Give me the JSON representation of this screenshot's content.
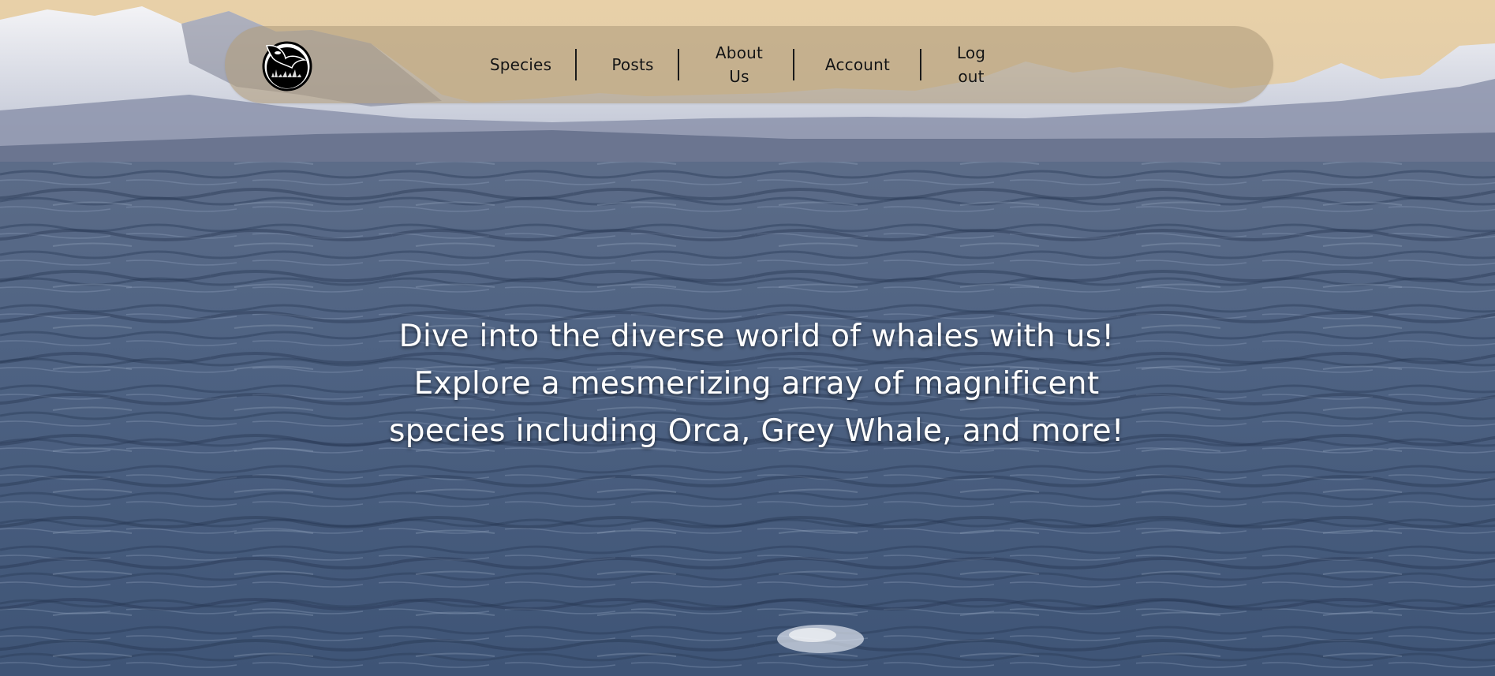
{
  "logo": {
    "icon": "orca-logo-icon"
  },
  "nav": {
    "items": [
      {
        "line1": "Species",
        "line2": ""
      },
      {
        "line1": "Posts",
        "line2": ""
      },
      {
        "line1": "About",
        "line2": "Us"
      },
      {
        "line1": "Account",
        "line2": ""
      },
      {
        "line1": "Log",
        "line2": "out"
      }
    ]
  },
  "hero": {
    "line1": "Dive into the diverse world of whales with us!",
    "line2": "Explore a mesmerizing array of magnificent",
    "line3": "species including Orca, Grey Whale, and more!"
  },
  "colors": {
    "nav_background": "#b29e7e",
    "nav_text": "#141414",
    "hero_text": "#ffffff",
    "sky": "#e8cfa6",
    "ocean": "#4d6180"
  }
}
